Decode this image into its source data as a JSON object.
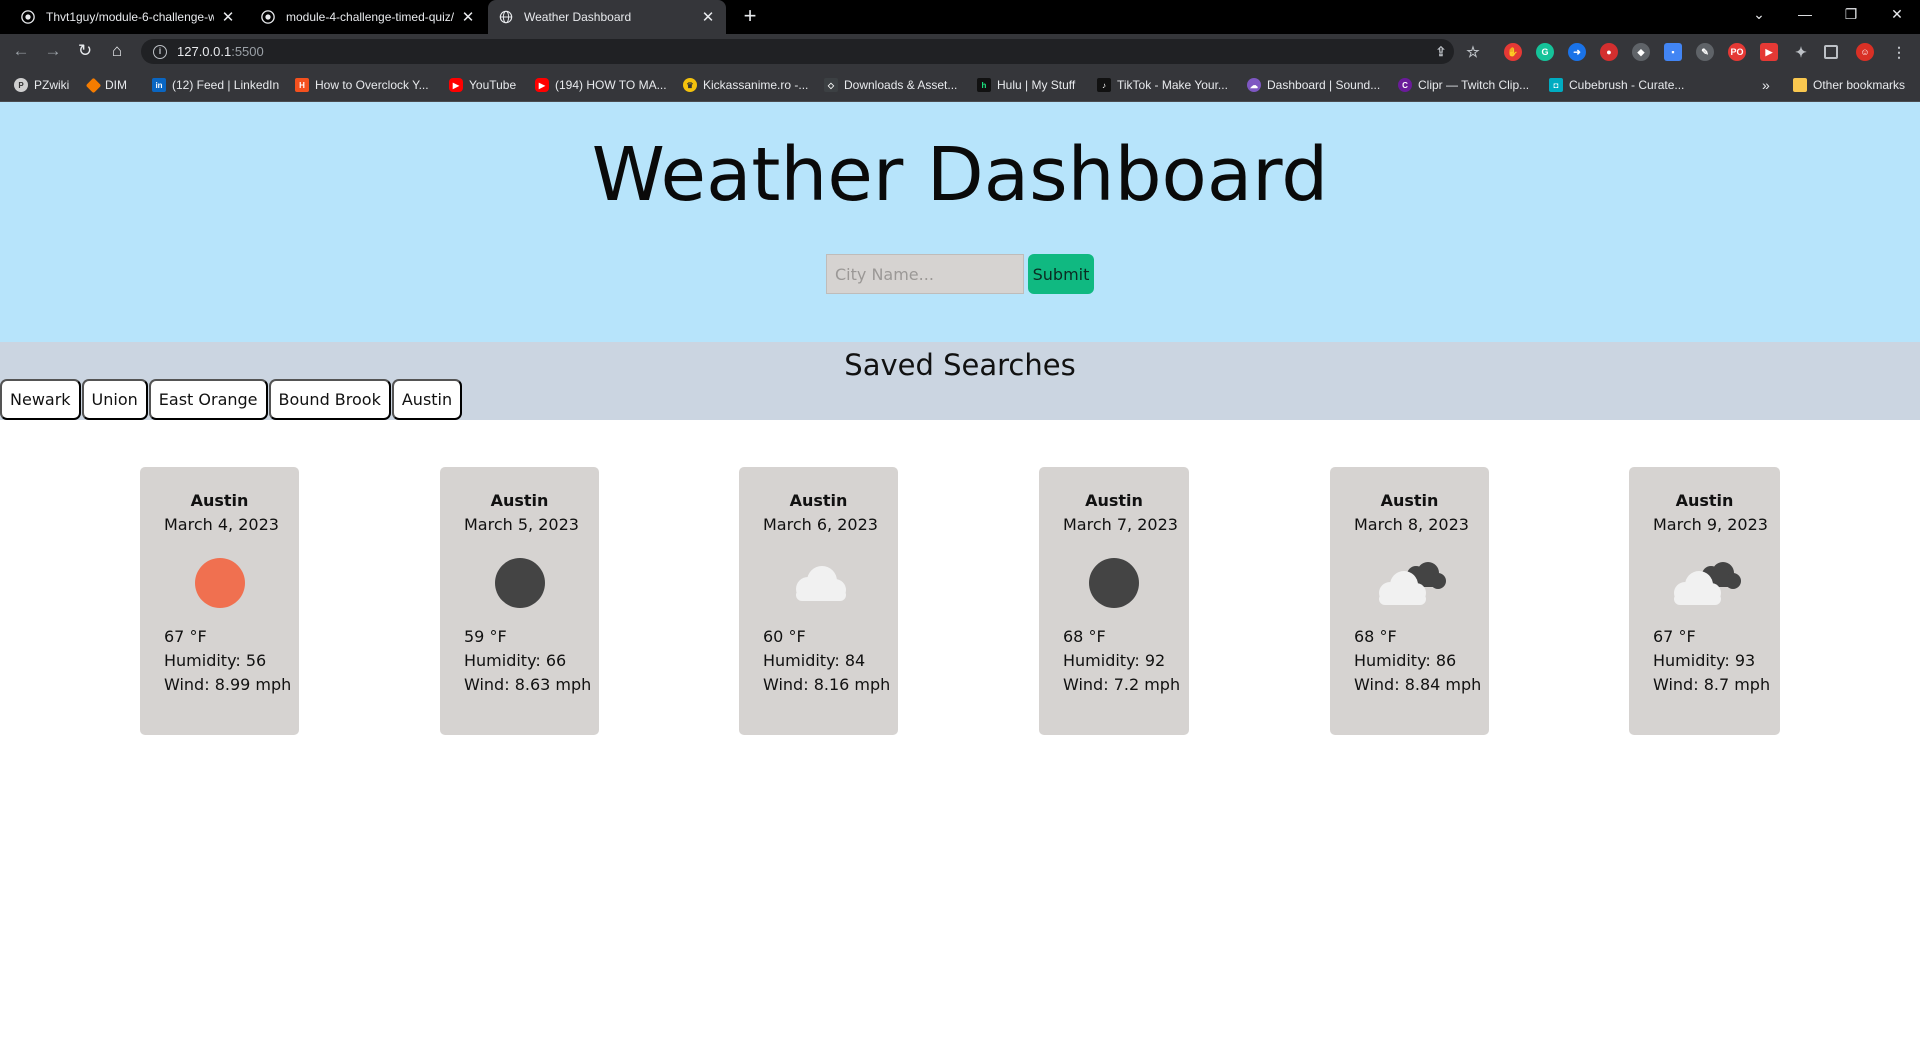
{
  "browser": {
    "tabs": [
      {
        "title": "Thvt1guy/module-6-challenge-w",
        "favicon": "github-icon"
      },
      {
        "title": "module-4-challenge-timed-quiz/",
        "favicon": "github-icon"
      },
      {
        "title": "Weather Dashboard",
        "favicon": "globe-icon"
      }
    ],
    "url_host": "127.0.0.1",
    "url_port": ":5500",
    "bookmarks": [
      {
        "label": "PZwiki"
      },
      {
        "label": "DIM"
      },
      {
        "label": "(12) Feed | LinkedIn"
      },
      {
        "label": "How to Overclock Y..."
      },
      {
        "label": "YouTube"
      },
      {
        "label": "(194) HOW TO MA..."
      },
      {
        "label": "Kickassanime.ro -..."
      },
      {
        "label": "Downloads & Asset..."
      },
      {
        "label": "Hulu | My Stuff"
      },
      {
        "label": "TikTok - Make Your..."
      },
      {
        "label": "Dashboard | Sound..."
      },
      {
        "label": "Clipr — Twitch Clip..."
      },
      {
        "label": "Cubebrush - Curate..."
      }
    ],
    "bookmarks_overflow": "»",
    "other_bookmarks": "Other bookmarks"
  },
  "header": {
    "title": "Weather Dashboard",
    "search_placeholder": "City Name...",
    "submit_label": "Submit"
  },
  "saved": {
    "title": "Saved Searches",
    "cities": [
      "Newark",
      "Union",
      "East Orange",
      "Bound Brook",
      "Austin"
    ]
  },
  "forecast": [
    {
      "city": "Austin",
      "date": "March 4, 2023",
      "icon": "sun-icon",
      "temp": "67 °F",
      "humidity": "Humidity: 56",
      "wind": "Wind: 8.99 mph"
    },
    {
      "city": "Austin",
      "date": "March 5, 2023",
      "icon": "moon-icon",
      "temp": "59 °F",
      "humidity": "Humidity: 66",
      "wind": "Wind: 8.63 mph"
    },
    {
      "city": "Austin",
      "date": "March 6, 2023",
      "icon": "cloud-icon",
      "temp": "60 °F",
      "humidity": "Humidity: 84",
      "wind": "Wind: 8.16 mph"
    },
    {
      "city": "Austin",
      "date": "March 7, 2023",
      "icon": "moon-icon",
      "temp": "68 °F",
      "humidity": "Humidity: 92",
      "wind": "Wind: 7.2 mph"
    },
    {
      "city": "Austin",
      "date": "March 8, 2023",
      "icon": "broken-clouds-icon",
      "temp": "68 °F",
      "humidity": "Humidity: 86",
      "wind": "Wind: 8.84 mph"
    },
    {
      "city": "Austin",
      "date": "March 9, 2023",
      "icon": "broken-clouds-icon",
      "temp": "67 °F",
      "humidity": "Humidity: 93",
      "wind": "Wind: 8.7 mph"
    }
  ],
  "colors": {
    "hero_bg": "#b7e4fb",
    "saved_bg": "#cbd5e1",
    "card_bg": "#d6d3d1",
    "submit_bg": "#10b981",
    "sun": "#f07050",
    "moon": "#444444",
    "cloud_light": "#f1f1f1"
  }
}
